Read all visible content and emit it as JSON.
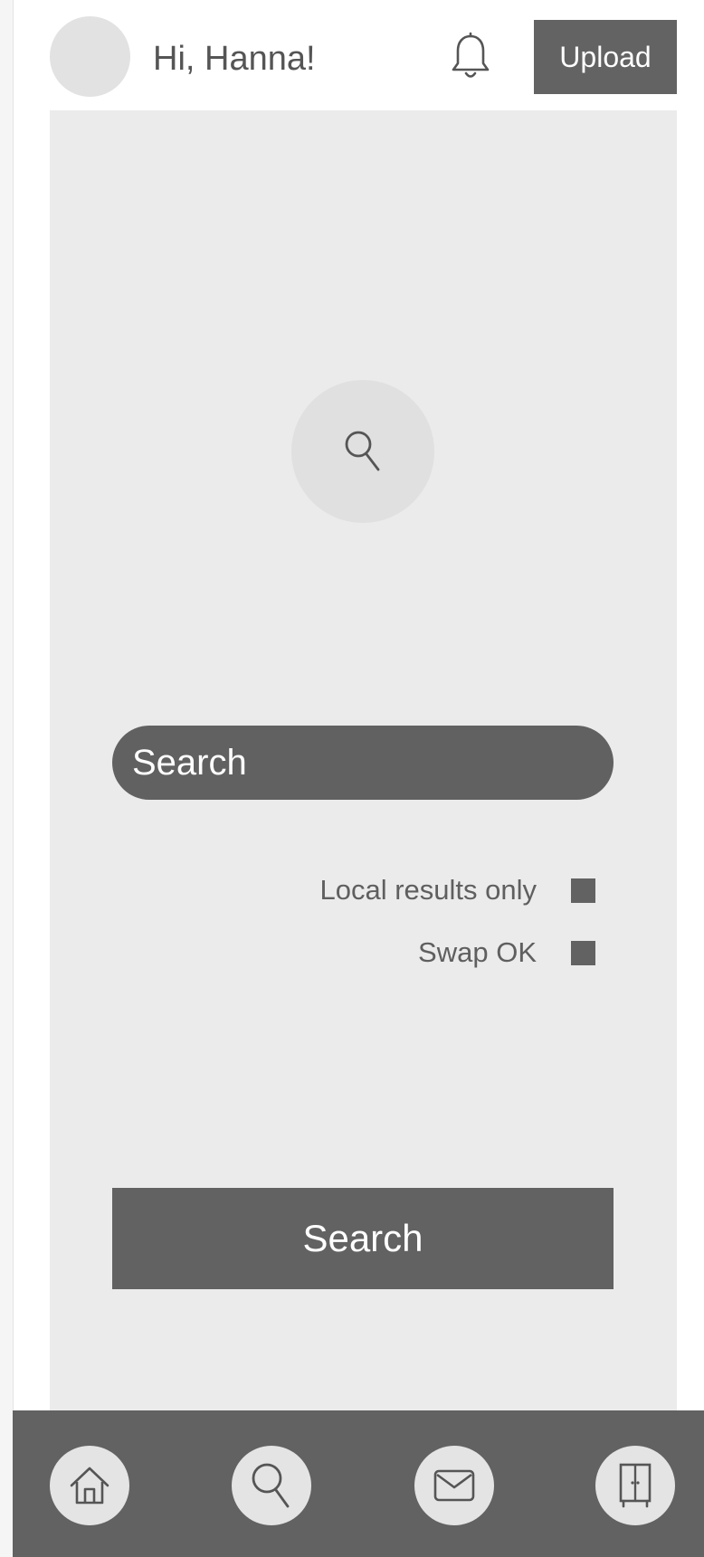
{
  "header": {
    "greeting": "Hi, Hanna!",
    "avatar_icon": "avatar-placeholder",
    "notification_icon": "bell-icon",
    "upload_label": "Upload"
  },
  "main": {
    "hero_icon": "search-icon",
    "search": {
      "placeholder": "Search"
    },
    "options": [
      {
        "label": "Local results only",
        "checked": true
      },
      {
        "label": "Swap OK",
        "checked": true
      }
    ],
    "submit_label": "Search"
  },
  "bottom_nav": {
    "items": [
      {
        "icon": "home-icon"
      },
      {
        "icon": "search-icon"
      },
      {
        "icon": "mail-icon"
      },
      {
        "icon": "wardrobe-icon"
      }
    ]
  },
  "colors": {
    "dark": "#626262",
    "panel": "#ebebeb",
    "circle": "#e2e2e2",
    "text": "#555555"
  }
}
